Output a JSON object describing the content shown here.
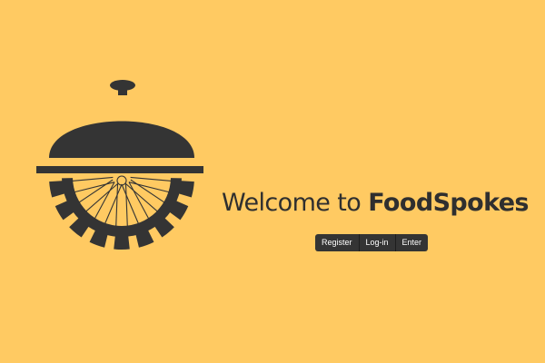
{
  "welcome": {
    "prefix": "Welcome to ",
    "brand": "FoodSpokes"
  },
  "actions": {
    "register": "Register",
    "login": "Log-in",
    "enter": "Enter"
  },
  "colors": {
    "background": "#FFCA62",
    "primary_dark": "#343434",
    "button_text": "#FFFFFF"
  },
  "icons": {
    "logo": "cloche-gear-wheel-logo"
  }
}
